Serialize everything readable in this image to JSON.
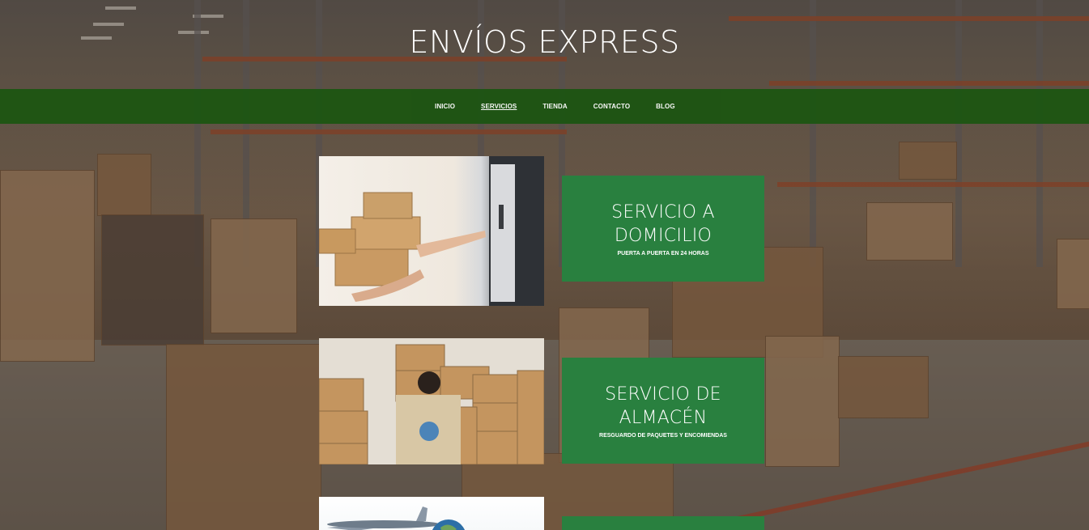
{
  "site": {
    "title": "ENVÍOS EXPRESS"
  },
  "nav": {
    "items": [
      {
        "label": "INICIO",
        "active": false
      },
      {
        "label": "SERVICIOS",
        "active": true
      },
      {
        "label": "TIENDA",
        "active": false
      },
      {
        "label": "CONTACTO",
        "active": false
      },
      {
        "label": "BLOG",
        "active": false
      }
    ]
  },
  "services": [
    {
      "title_line1": "SERVICIO A",
      "title_line2": "DOMICILIO",
      "subtitle": "PUERTA A PUERTA EN 24 HORAS",
      "image": "package-delivery-image"
    },
    {
      "title_line1": "SERVICIO DE",
      "title_line2": "ALMACÉN",
      "subtitle": "RESGUARDO DE PAQUETES Y ENCOMIENDAS",
      "image": "warehouse-worker-image"
    },
    {
      "title_line1": "",
      "title_line2": "",
      "subtitle": "",
      "image": "airplane-globe-image"
    }
  ],
  "colors": {
    "nav_bg": "#1d5513",
    "card_bg": "#29803f",
    "text": "#ffffff"
  }
}
